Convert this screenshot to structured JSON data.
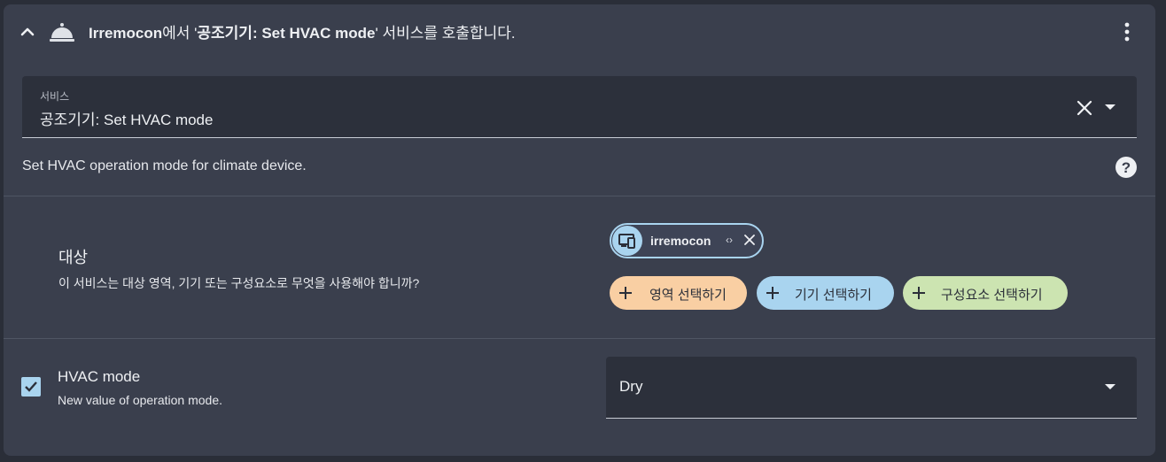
{
  "header": {
    "title_entity": "Irremocon",
    "title_mid": "에서 '",
    "title_service": "공조기기: Set HVAC mode",
    "title_end": "' 서비스를 호출합니다."
  },
  "service": {
    "label": "서비스",
    "value": "공조기기: Set HVAC mode"
  },
  "description": "Set HVAC operation mode for climate device.",
  "target": {
    "title": "대상",
    "subtitle": "이 서비스는 대상 영역, 기기 또는 구성요소로 무엇을 사용해야 합니까?",
    "chip": {
      "label": "irremocon",
      "code": "‹›",
      "icon": "devices-icon"
    },
    "buttons": {
      "area": "영역 선택하기",
      "device": "기기 선택하기",
      "entity": "구성요소 선택하기"
    }
  },
  "hvac_mode": {
    "checked": true,
    "title": "HVAC mode",
    "subtitle": "New value of operation mode.",
    "value": "Dry"
  },
  "colors": {
    "card": "#3a3f4d",
    "field": "#2c303b",
    "blue": "#a9d4ef",
    "orange": "#f9cfa3",
    "green": "#cce4b1"
  }
}
